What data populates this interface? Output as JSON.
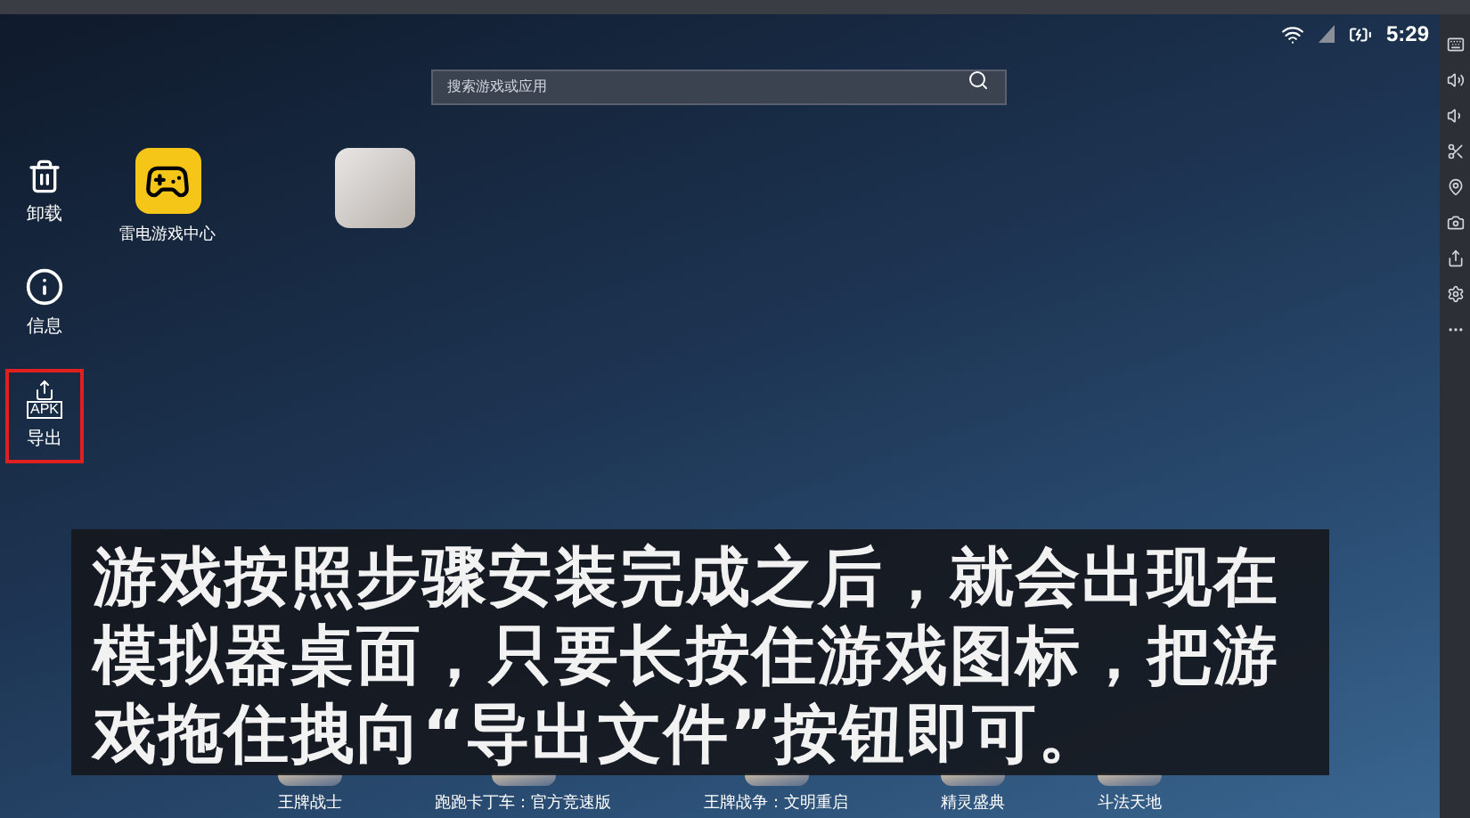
{
  "status_bar": {
    "time": "5:29"
  },
  "search": {
    "placeholder": "搜索游戏或应用"
  },
  "side_actions": [
    {
      "kind": "trash",
      "label": "卸载",
      "selected": false
    },
    {
      "kind": "info",
      "label": "信息",
      "selected": false
    },
    {
      "kind": "apk",
      "icon_text": "APK",
      "label": "导出",
      "selected": true
    }
  ],
  "desktop_apps": [
    {
      "kind": "gamepad",
      "label": "雷电游戏中心"
    },
    {
      "kind": "game"
    }
  ],
  "dock": [
    "王牌战士",
    "跑跑卡丁车：官方竞速版",
    "王牌战争：文明重启",
    "精灵盛典",
    "斗法天地"
  ],
  "caption": "游戏按照步骤安装完成之后，就会出现在模拟器桌面，只要长按住游戏图标，把游戏拖住拽向“导出文件”按钮即可。"
}
